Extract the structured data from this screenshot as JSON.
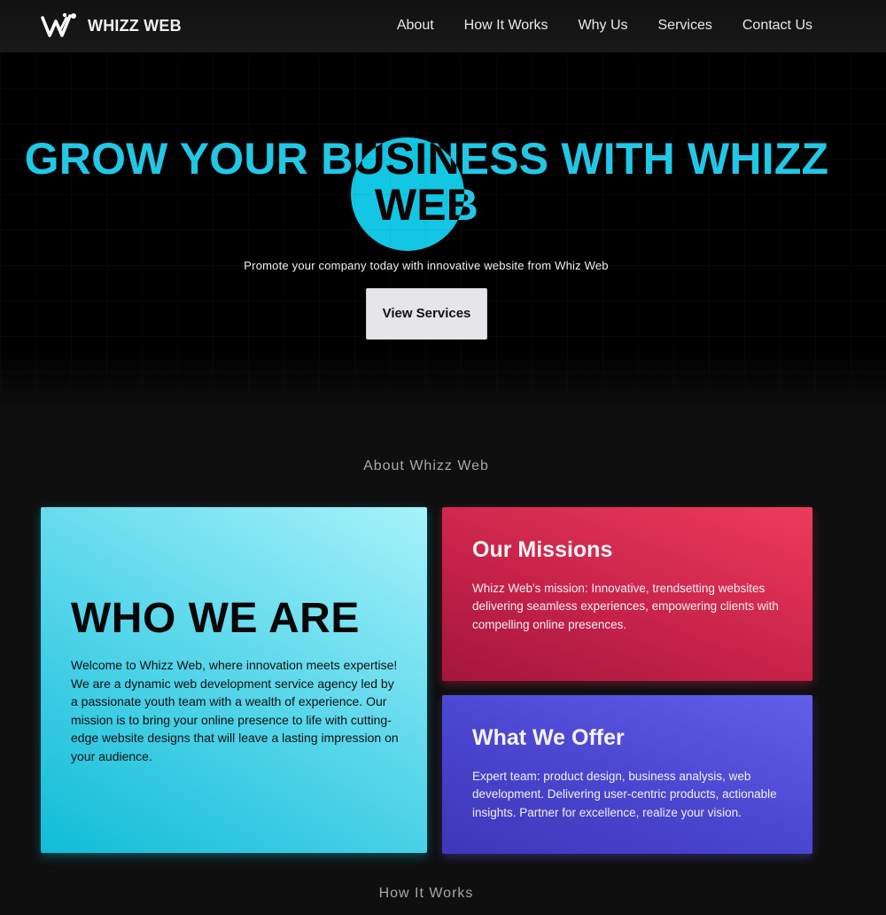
{
  "nav": {
    "logo_text": "WHIZZ WEB",
    "logo_icon": "whizz-web-logo-icon",
    "links": [
      "About",
      "How It Works",
      "Why Us",
      "Services",
      "Contact Us"
    ]
  },
  "hero": {
    "title": "GROW YOUR BUSINESS WITH WHIZZ WEB",
    "subtitle": "Promote your company today with innovative website from Whiz Web",
    "button_label": "View Services",
    "accent_color": "#22c7e6"
  },
  "about": {
    "section_heading": "About Whizz Web",
    "who": {
      "title": "WHO WE ARE",
      "text": "Welcome to Whizz Web, where innovation meets expertise! We are a dynamic web development service agency led by a passionate youth team with a wealth of experience. Our mission is to bring your online presence to life with cutting-edge website designs that will leave a lasting impression on your audience."
    },
    "mission": {
      "title": "Our Missions",
      "text": "Whizz Web's mission: Innovative, trendsetting websites delivering seamless experiences, empowering clients with compelling online presences."
    },
    "offer": {
      "title": "What We Offer",
      "text": "Expert team: product design, business analysis, web development. Delivering user-centric products, actionable insights. Partner for excellence, realize your vision."
    }
  },
  "how": {
    "section_heading": "How It Works"
  },
  "colors": {
    "cyan_card": "#5fd9ec",
    "red_card": "#c8234a",
    "purple_card": "#4a45cf"
  }
}
